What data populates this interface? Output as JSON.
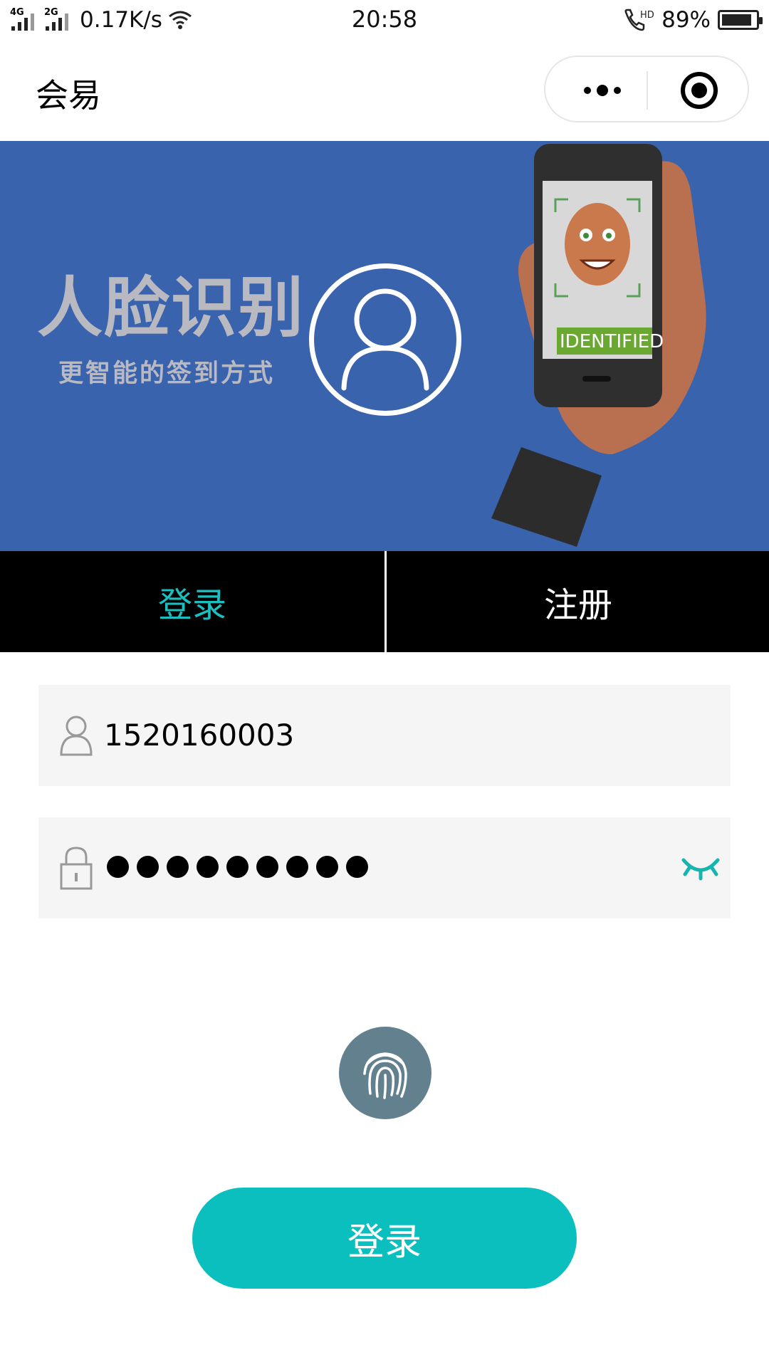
{
  "status_bar": {
    "network_1": "4G",
    "network_2": "2G",
    "speed": "0.17K/s",
    "time": "20:58",
    "call_badge": "HD",
    "battery_percent": "89%",
    "battery_level": 0.89
  },
  "nav": {
    "title": "会易"
  },
  "banner": {
    "title": "人脸识别",
    "subtitle": "更智能的签到方式",
    "badge_text": "IDENTIFIED",
    "background_color": "#3a63ae"
  },
  "tabs": [
    {
      "label": "登录",
      "active": true
    },
    {
      "label": "注册",
      "active": false
    }
  ],
  "form": {
    "username_value": "1520160003",
    "password_mask_count": 9
  },
  "login_button": {
    "label": "登录"
  },
  "colors": {
    "accent": "#0bbfbf",
    "active_tab_text": "#1bbfbf",
    "tab_bar": "#000000",
    "field_bg": "#f5f5f5",
    "fingerprint_bg": "#62808e"
  },
  "icons": {
    "user": "user-outline-icon",
    "lock": "lock-icon",
    "eye": "eye-closed-icon",
    "fingerprint": "fingerprint-icon",
    "more": "more-dots-icon",
    "close": "target-close-icon"
  }
}
